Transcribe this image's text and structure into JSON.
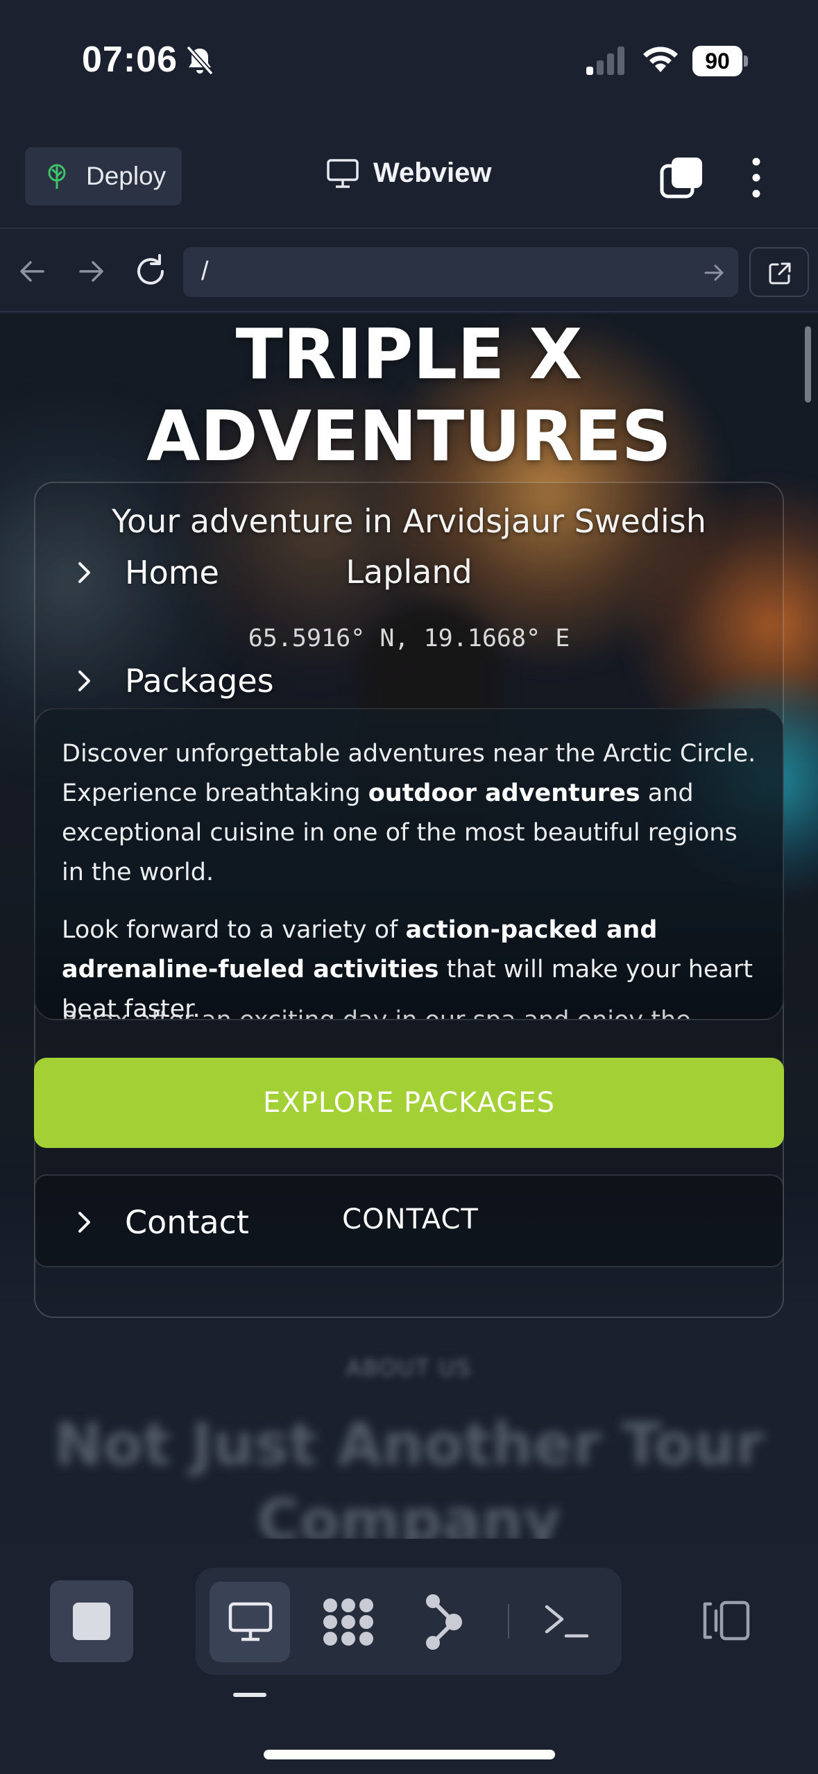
{
  "status_bar": {
    "time": "07:06",
    "battery": "90",
    "icons": [
      "bell-off-icon",
      "signal-icon",
      "wifi-icon",
      "battery-icon"
    ]
  },
  "header": {
    "deploy_label": "Deploy",
    "title": "Webview",
    "icons": [
      "deploy-tree-icon",
      "monitor-icon",
      "tabs-icon",
      "more-vertical-icon"
    ]
  },
  "url_bar": {
    "url": "/",
    "icons": [
      "arrow-left-icon",
      "arrow-right-icon",
      "reload-icon",
      "go-arrow-icon",
      "open-external-icon"
    ]
  },
  "page": {
    "title_line1": "TRIPLE X",
    "title_line2": "ADVENTURES",
    "subtitle_line1": "Your adventure in Arvidsjaur Swedish",
    "subtitle_line2": "Lapland",
    "coordinates": "65.5916° N, 19.1668° E",
    "nav": {
      "home": "Home",
      "packages": "Packages",
      "contact": "Contact"
    },
    "description": {
      "p1_a": "Discover unforgettable adventures near the Arctic Circle. Experience breathtaking ",
      "p1_bold": "outdoor adventures",
      "p1_b": " and exceptional cuisine in one of the most beautiful regions in the world.",
      "p2_a": "Look forward to a variety of ",
      "p2_bold": "action-packed and adrenaline-fueled activities",
      "p2_b": " that will make your heart beat faster.",
      "p3": "Relax after an exciting day in our spa and enjoy the"
    },
    "explore_button": "EXPLORE PACKAGES",
    "contact_button": "CONTACT",
    "about_label": "ABOUT US",
    "about_title_line1": "Not Just Another Tour",
    "about_title_line2": "Company"
  },
  "colors": {
    "app_background": "#1c2130",
    "accent_green": "#a3d034",
    "panel": "#2b3243"
  },
  "bottom_bar": {
    "icons": [
      "stop-icon",
      "webview-monitor-icon",
      "clusters-icon",
      "graph-icon",
      "terminal-icon",
      "layout-toggle-icon"
    ]
  }
}
